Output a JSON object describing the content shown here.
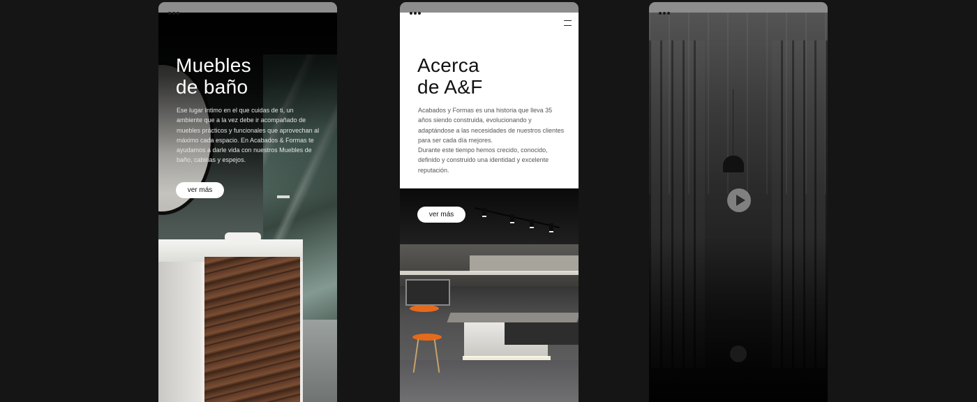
{
  "screens": [
    {
      "id": "banos",
      "heading_lines": [
        "Muebles",
        "de baño"
      ],
      "body": "Ese lugar íntimo en el que cuidas de ti, un ambiente que a la vez debe ir acompañado de muebles prácticos y funcionales que aprovechan al máximo cada espacio. En Acabados & Formas te ayudamos a darle vida con nuestros Muebles de baño, cabinas y espejos.",
      "button_label": "ver más"
    },
    {
      "id": "acerca",
      "heading_lines": [
        "Acerca",
        "de A&F"
      ],
      "body_paragraphs": [
        "Acabados y Formas es una historia que lleva 35 años siendo construida, evolucionando y adaptándose a las necesidades de nuestros clientes para ser cada día mejores.",
        "Durante este tiempo hemos crecido, conocido, definido y construido una identidad y excelente reputación."
      ],
      "button_label": "ver más",
      "menu_icon": "hamburger-menu-icon"
    },
    {
      "id": "video",
      "play_icon": "play-icon"
    }
  ],
  "colors": {
    "page_background": "#151515",
    "titlebar": "#8d8d8d",
    "button_background": "#ffffff",
    "accent_stool": "#e66a1c"
  }
}
